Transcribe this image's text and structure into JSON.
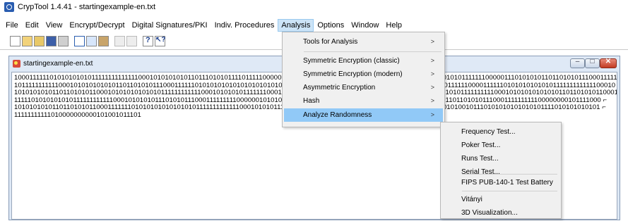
{
  "window": {
    "title": "CrypTool 1.4.41 - startingexample-en.txt",
    "icon": "cryptool-app-icon"
  },
  "menubar": {
    "items": [
      {
        "label": "File"
      },
      {
        "label": "Edit"
      },
      {
        "label": "View"
      },
      {
        "label": "Encrypt/Decrypt"
      },
      {
        "label": "Digital Signatures/PKI"
      },
      {
        "label": "Indiv. Procedures"
      },
      {
        "label": "Analysis",
        "active": true
      },
      {
        "label": "Options"
      },
      {
        "label": "Window"
      },
      {
        "label": "Help"
      }
    ]
  },
  "toolbar": {
    "buttons": [
      "new-icon",
      "open-icon",
      "open-folder-icon",
      "save-icon",
      "print-icon",
      "cut-icon",
      "copy-icon",
      "paste-icon",
      "key-icon",
      "properties-icon",
      "help-icon",
      "context-help-icon"
    ]
  },
  "document": {
    "title": "startingexample-en.txt",
    "lines": [
      "10001111110101010101011111111111111000101010101011011101010111101111100000000000101001011101010101010111101010101010101010111111100000111010101011011010101110001111111010101010 ⌐",
      "10111111111110001010101010101101101010111000111111010101010101010101010101010101011010111101010101010101010101010101011111100001111110101010101010111111111111100010 ⌐",
      "1010101010110110101011000101010101010101111111111110001010101011111110001010101010101010101010101010101010101010101010101111111111000101010101010101101101010110001000 ⌐",
      "11111010101010101111111111110001010101011101010111000111111111000000101010101010101010101010111111000001111010101010101101101010111000111111111100000000101111000 ⌐",
      "10101010101101101010110001111111010101010101010101111111111111000101010111101010101010101101010101010101010000000000010100101110101010101010101111010101010101 ⌐",
      "11111111111010000000000101001011101"
    ]
  },
  "analysis_menu": {
    "items": [
      {
        "label": "Tools for Analysis",
        "arrow": ">"
      },
      {
        "label": "Symmetric Encryption (classic)",
        "arrow": ">"
      },
      {
        "label": "Symmetric Encryption (modern)",
        "arrow": ">"
      },
      {
        "label": "Asymmetric Encryption",
        "arrow": ">"
      },
      {
        "label": "Hash",
        "arrow": ">"
      },
      {
        "label": "Analyze Randomness",
        "arrow": ">",
        "highlighted": true
      }
    ]
  },
  "randomness_submenu": {
    "items": [
      {
        "label": "Frequency Test..."
      },
      {
        "label": "Poker Test..."
      },
      {
        "label": "Runs Test..."
      },
      {
        "label": "Serial Test..."
      },
      {
        "label": "FIPS PUB-140-1 Test Battery"
      },
      {
        "label": "Vitányi"
      },
      {
        "label": "3D Visualization..."
      }
    ]
  },
  "colors": {
    "menu_highlight": "#91c9f7",
    "menubar_active": "#cce4f7",
    "doc_frame": "#dde8f5",
    "close_button": "#c23a22"
  }
}
